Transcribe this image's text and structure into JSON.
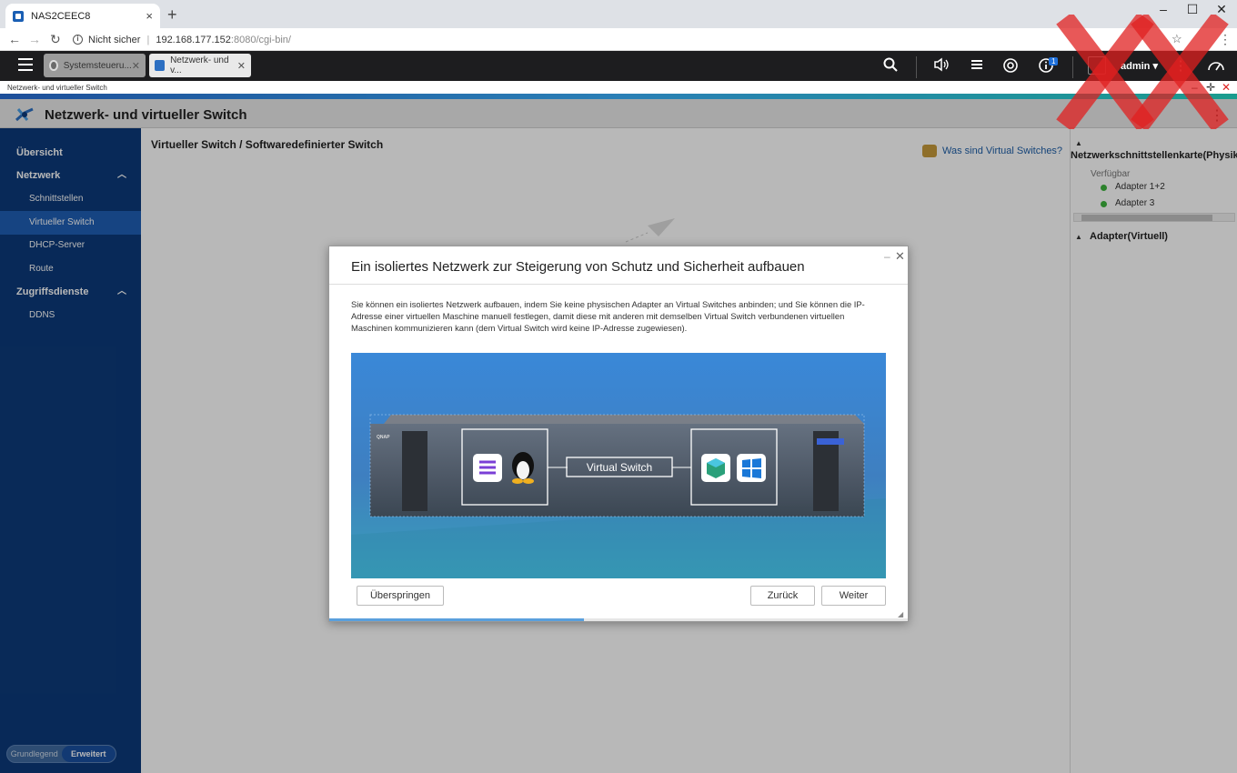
{
  "browser": {
    "tab_title": "NAS2CEEC8",
    "new_tab": "+",
    "tab_close": "×",
    "minimize": "–",
    "maximize": "☐",
    "close": "✕",
    "security_label": "Nicht sicher",
    "url_host": "192.168.177.152",
    "url_path": ":8080/cgi-bin/"
  },
  "qts": {
    "app_tabs": [
      {
        "label": "Systemsteueru...",
        "close": "✕"
      },
      {
        "label": "Netzwerk- und v...",
        "close": "✕"
      }
    ],
    "notification_count": "1",
    "user": "admin ▾"
  },
  "window": {
    "caption": "Netzwerk- und virtueller Switch",
    "app_title": "Netzwerk- und virtueller Switch"
  },
  "sidebar": {
    "items": [
      {
        "label": "Übersicht"
      },
      {
        "label": "Netzwerk"
      },
      {
        "label": "Schnittstellen"
      },
      {
        "label": "Virtueller Switch"
      },
      {
        "label": "DHCP-Server"
      },
      {
        "label": "Route"
      },
      {
        "label": "Zugriffsdienste"
      },
      {
        "label": "DDNS"
      }
    ],
    "mode_basic": "Grundlegend",
    "mode_advanced": "Erweitert"
  },
  "main": {
    "breadcrumb": "Virtueller Switch / Softwaredefinierter Switch",
    "help_link": "Was sind Virtual Switches?"
  },
  "right_panel": {
    "physical_header": "Netzwerkschnittstellenkarte(Physikalisch)",
    "available_label": "Verfügbar",
    "adapters": [
      "Adapter 1+2",
      "Adapter 3"
    ],
    "virtual_header": "Adapter(Virtuell)"
  },
  "dialog": {
    "title": "Ein isoliertes Netzwerk zur Steigerung von Schutz und Sicherheit aufbauen",
    "description": "Sie können ein isoliertes Netzwerk aufbauen, indem Sie keine physischen Adapter an Virtual Switches anbinden; und Sie können die IP-Adresse einer virtuellen Maschine manuell festlegen, damit diese mit anderen mit demselben Virtual Switch verbundenen virtuellen Maschinen kommunizieren kann (dem Virtual Switch wird keine IP-Adresse zugewiesen).",
    "illustration_label": "Virtual Switch",
    "nas_brand": "QNAP",
    "skip_button": "Überspringen",
    "back_button": "Zurück",
    "next_button": "Weiter",
    "progress": 0.44
  },
  "colors": {
    "sidebar_bg": "#0c3a7a",
    "sidebar_selected": "#1f5fb4",
    "accent_link": "#1e5fa8",
    "available_dot": "#3db43d"
  }
}
